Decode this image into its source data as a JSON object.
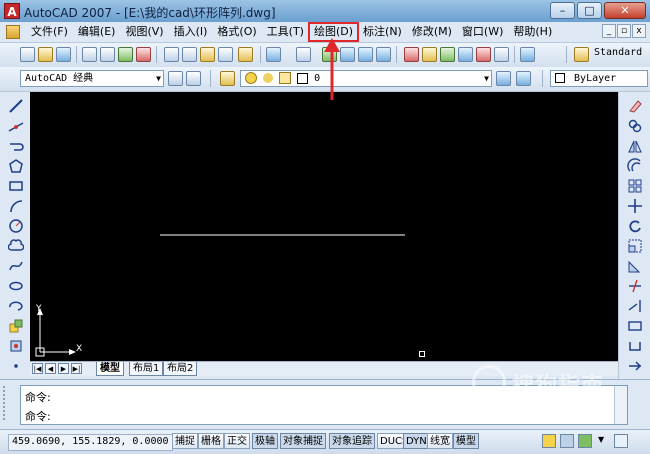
{
  "window": {
    "title": "AutoCAD 2007 - [E:\\我的cad\\环形阵列.dwg]",
    "app_icon": "autocad-logo-icon",
    "app_icon_glyph": "A",
    "min_glyph": "–",
    "max_glyph": "□",
    "close_glyph": "✕"
  },
  "menubar": {
    "items": [
      {
        "label": "文件(F)"
      },
      {
        "label": "编辑(E)"
      },
      {
        "label": "视图(V)"
      },
      {
        "label": "插入(I)"
      },
      {
        "label": "格式(O)"
      },
      {
        "label": "工具(T)"
      },
      {
        "label": "绘图(D)",
        "highlighted": true
      },
      {
        "label": "标注(N)"
      },
      {
        "label": "修改(M)"
      },
      {
        "label": "窗口(W)"
      },
      {
        "label": "帮助(H)"
      }
    ],
    "mdi_min": "_",
    "mdi_restore": "▫",
    "mdi_close": "x"
  },
  "toolbar2": {
    "workspace": "AutoCAD 经典",
    "layer": "0",
    "linetype": "ByLayer",
    "text_style": "Standard"
  },
  "layout_tabs": {
    "tabs": [
      "模型",
      "布局1",
      "布局2"
    ],
    "active": 0,
    "nav": [
      "|◀",
      "◀",
      "▶",
      "▶|"
    ]
  },
  "canvas": {
    "ucs_y": "Y",
    "ucs_x": "X",
    "background_color": "#000000",
    "line_color": "#ffffff"
  },
  "command": {
    "lines": [
      "命令:",
      "命令:"
    ]
  },
  "status": {
    "coordinates": "459.0690, 155.1829, 0.0000",
    "toggles": [
      "捕捉",
      "栅格",
      "正交",
      "极轴",
      "对象捕捉",
      "对象追踪",
      "DUCS",
      "DYN",
      "线宽",
      "模型"
    ]
  },
  "watermark": {
    "text": "搜狗指南"
  },
  "colors": {
    "highlight": "#e0282c",
    "title_gradient_top": "#9cc4e6"
  }
}
